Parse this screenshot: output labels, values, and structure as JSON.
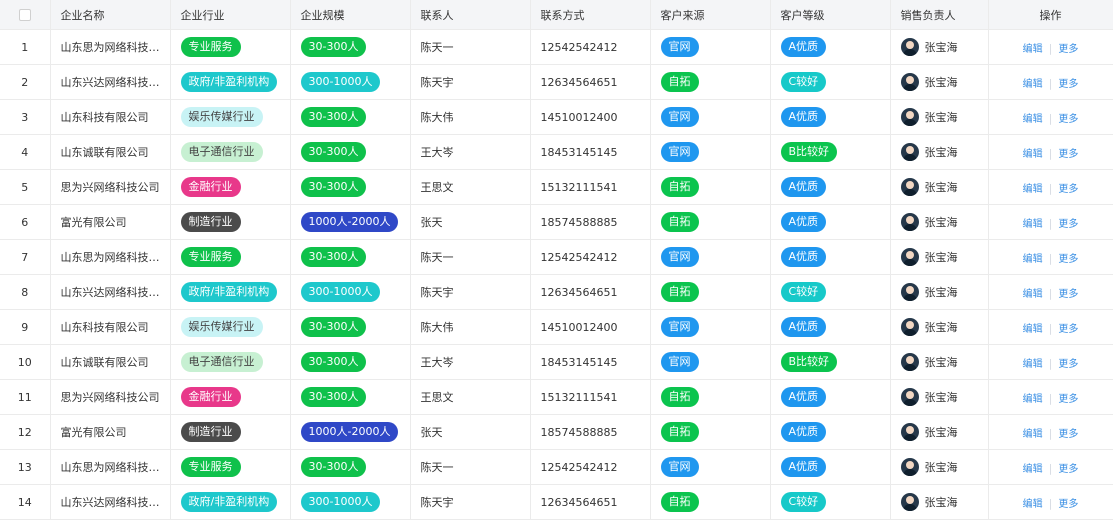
{
  "header": {
    "name": "企业名称",
    "industry": "企业行业",
    "scale": "企业规模",
    "contact": "联系人",
    "phone": "联系方式",
    "source": "客户来源",
    "level": "客户等级",
    "sales": "销售负责人",
    "ops": "操作"
  },
  "rows": [
    {
      "idx": "1",
      "name": "山东思为网络科技有...",
      "industry": "专业服务",
      "scale": "30-300人",
      "contact": "陈天一",
      "phone": "12542542412",
      "source": "官网",
      "level": "A优质",
      "sales": "张宝海"
    },
    {
      "idx": "2",
      "name": "山东兴达网络科技有...",
      "industry": "政府/非盈利机构",
      "scale": "300-1000人",
      "contact": "陈天宇",
      "phone": "12634564651",
      "source": "自拓",
      "level": "C较好",
      "sales": "张宝海"
    },
    {
      "idx": "3",
      "name": "山东科技有限公司",
      "industry": "娱乐传媒行业",
      "scale": "30-300人",
      "contact": "陈大伟",
      "phone": "14510012400",
      "source": "官网",
      "level": "A优质",
      "sales": "张宝海"
    },
    {
      "idx": "4",
      "name": "山东诚联有限公司",
      "industry": "电子通信行业",
      "scale": "30-300人",
      "contact": "王大岑",
      "phone": "18453145145",
      "source": "官网",
      "level": "B比较好",
      "sales": "张宝海"
    },
    {
      "idx": "5",
      "name": "思为兴网络科技公司",
      "industry": "金融行业",
      "scale": "30-300人",
      "contact": "王思文",
      "phone": "15132111541",
      "source": "自拓",
      "level": "A优质",
      "sales": "张宝海"
    },
    {
      "idx": "6",
      "name": "富光有限公司",
      "industry": "制造行业",
      "scale": "1000人-2000人",
      "contact": "张天",
      "phone": "18574588885",
      "source": "自拓",
      "level": "A优质",
      "sales": "张宝海"
    },
    {
      "idx": "7",
      "name": "山东思为网络科技有...",
      "industry": "专业服务",
      "scale": "30-300人",
      "contact": "陈天一",
      "phone": "12542542412",
      "source": "官网",
      "level": "A优质",
      "sales": "张宝海"
    },
    {
      "idx": "8",
      "name": "山东兴达网络科技有...",
      "industry": "政府/非盈利机构",
      "scale": "300-1000人",
      "contact": "陈天宇",
      "phone": "12634564651",
      "source": "自拓",
      "level": "C较好",
      "sales": "张宝海"
    },
    {
      "idx": "9",
      "name": "山东科技有限公司",
      "industry": "娱乐传媒行业",
      "scale": "30-300人",
      "contact": "陈大伟",
      "phone": "14510012400",
      "source": "官网",
      "level": "A优质",
      "sales": "张宝海"
    },
    {
      "idx": "10",
      "name": "山东诚联有限公司",
      "industry": "电子通信行业",
      "scale": "30-300人",
      "contact": "王大岑",
      "phone": "18453145145",
      "source": "官网",
      "level": "B比较好",
      "sales": "张宝海"
    },
    {
      "idx": "11",
      "name": "思为兴网络科技公司",
      "industry": "金融行业",
      "scale": "30-300人",
      "contact": "王思文",
      "phone": "15132111541",
      "source": "自拓",
      "level": "A优质",
      "sales": "张宝海"
    },
    {
      "idx": "12",
      "name": "富光有限公司",
      "industry": "制造行业",
      "scale": "1000人-2000人",
      "contact": "张天",
      "phone": "18574588885",
      "source": "自拓",
      "level": "A优质",
      "sales": "张宝海"
    },
    {
      "idx": "13",
      "name": "山东思为网络科技有...",
      "industry": "专业服务",
      "scale": "30-300人",
      "contact": "陈天一",
      "phone": "12542542412",
      "source": "官网",
      "level": "A优质",
      "sales": "张宝海"
    },
    {
      "idx": "14",
      "name": "山东兴达网络科技有...",
      "industry": "政府/非盈利机构",
      "scale": "300-1000人",
      "contact": "陈天宇",
      "phone": "12634564651",
      "source": "自拓",
      "level": "C较好",
      "sales": "张宝海"
    }
  ],
  "actions": {
    "edit": "编辑",
    "more": "更多"
  },
  "colors": {
    "industry": {
      "专业服务": "p-green",
      "政府/非盈利机构": "p-cyan",
      "娱乐传媒行业": "p-lcyan",
      "电子通信行业": "p-lgreen",
      "金融行业": "p-pink",
      "制造行业": "p-dark"
    },
    "scale": {
      "30-300人": "p-green",
      "300-1000人": "p-cyan",
      "1000人-2000人": "p-navy"
    },
    "source": {
      "官网": "p-blue",
      "自拓": "p-bgreen"
    },
    "level": {
      "A优质": "p-blue",
      "C较好": "p-teal",
      "B比较好": "p-bgreen"
    }
  }
}
